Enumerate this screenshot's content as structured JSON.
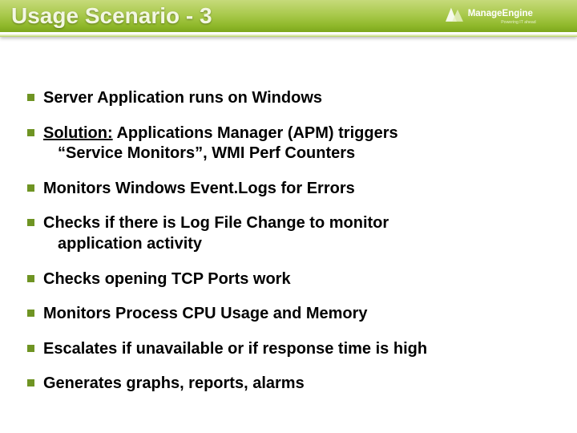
{
  "header": {
    "title": "Usage Scenario - 3",
    "logo_brand": "ManageEngine",
    "logo_tagline": "Powering IT ahead"
  },
  "bullets": [
    {
      "text": "Server Application runs on Windows"
    },
    {
      "solution_label": "Solution:",
      "text_after": " Applications Manager (APM) triggers",
      "line2": "“Service Monitors”, WMI Perf Counters"
    },
    {
      "text": "Monitors Windows Event.Logs for Errors"
    },
    {
      "text": "Checks if there is Log File Change to monitor",
      "line2": "application activity"
    },
    {
      "text": "Checks opening TCP Ports work"
    },
    {
      "text": "Monitors Process CPU Usage and Memory"
    },
    {
      "text": "Escalates if unavailable or if response time is high"
    },
    {
      "text": "Generates graphs, reports, alarms"
    }
  ]
}
